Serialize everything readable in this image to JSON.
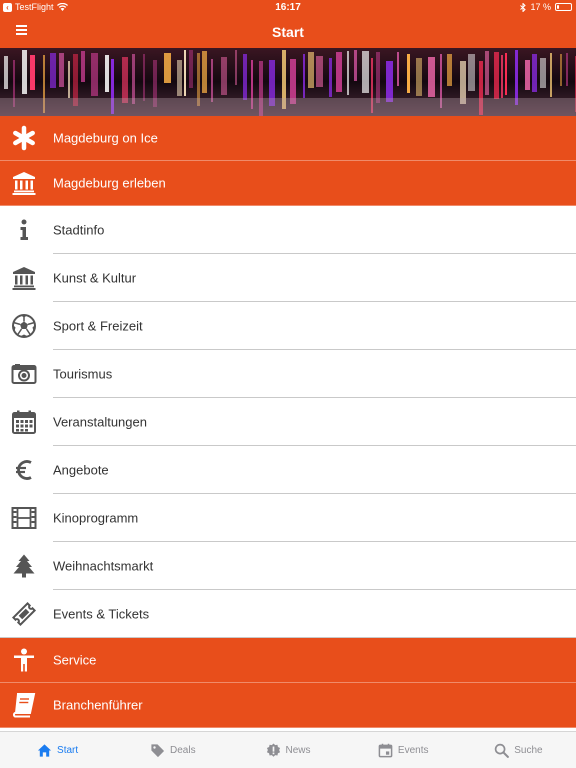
{
  "status_bar": {
    "back_app": "TestFlight",
    "time": "16:17",
    "battery_text": "17 %",
    "battery_level": 0.17
  },
  "nav": {
    "title": "Start"
  },
  "colors": {
    "accent": "#E84E1B",
    "tab_active": "#1a7cf0",
    "tab_inactive": "#8e8e93",
    "icon_gray": "#555555"
  },
  "menu": {
    "sections": [
      {
        "label": "Magdeburg on Ice",
        "icon": "asterisk-icon",
        "style": "orange"
      },
      {
        "label": "Magdeburg erleben",
        "icon": "museum-icon",
        "style": "orange"
      }
    ],
    "items": [
      {
        "label": "Stadtinfo",
        "icon": "info-icon"
      },
      {
        "label": "Kunst & Kultur",
        "icon": "museum-icon"
      },
      {
        "label": "Sport & Freizeit",
        "icon": "soccer-ball-icon"
      },
      {
        "label": "Tourismus",
        "icon": "camera-icon"
      },
      {
        "label": "Veranstaltungen",
        "icon": "calendar-icon"
      },
      {
        "label": "Angebote",
        "icon": "euro-icon"
      },
      {
        "label": "Kinoprogramm",
        "icon": "film-icon"
      },
      {
        "label": "Weihnachtsmarkt",
        "icon": "tree-icon"
      },
      {
        "label": "Events & Tickets",
        "icon": "ticket-icon"
      }
    ],
    "footer_sections": [
      {
        "label": "Service",
        "icon": "person-icon",
        "style": "orange"
      },
      {
        "label": "Branchenführer",
        "icon": "book-icon",
        "style": "orange"
      }
    ]
  },
  "tabbar": {
    "tabs": [
      {
        "label": "Start",
        "icon": "home-icon",
        "active": true
      },
      {
        "label": "Deals",
        "icon": "tag-icon",
        "active": false
      },
      {
        "label": "News",
        "icon": "alert-badge-icon",
        "active": false
      },
      {
        "label": "Events",
        "icon": "calendar-icon",
        "active": false
      },
      {
        "label": "Suche",
        "icon": "search-icon",
        "active": false
      }
    ]
  }
}
